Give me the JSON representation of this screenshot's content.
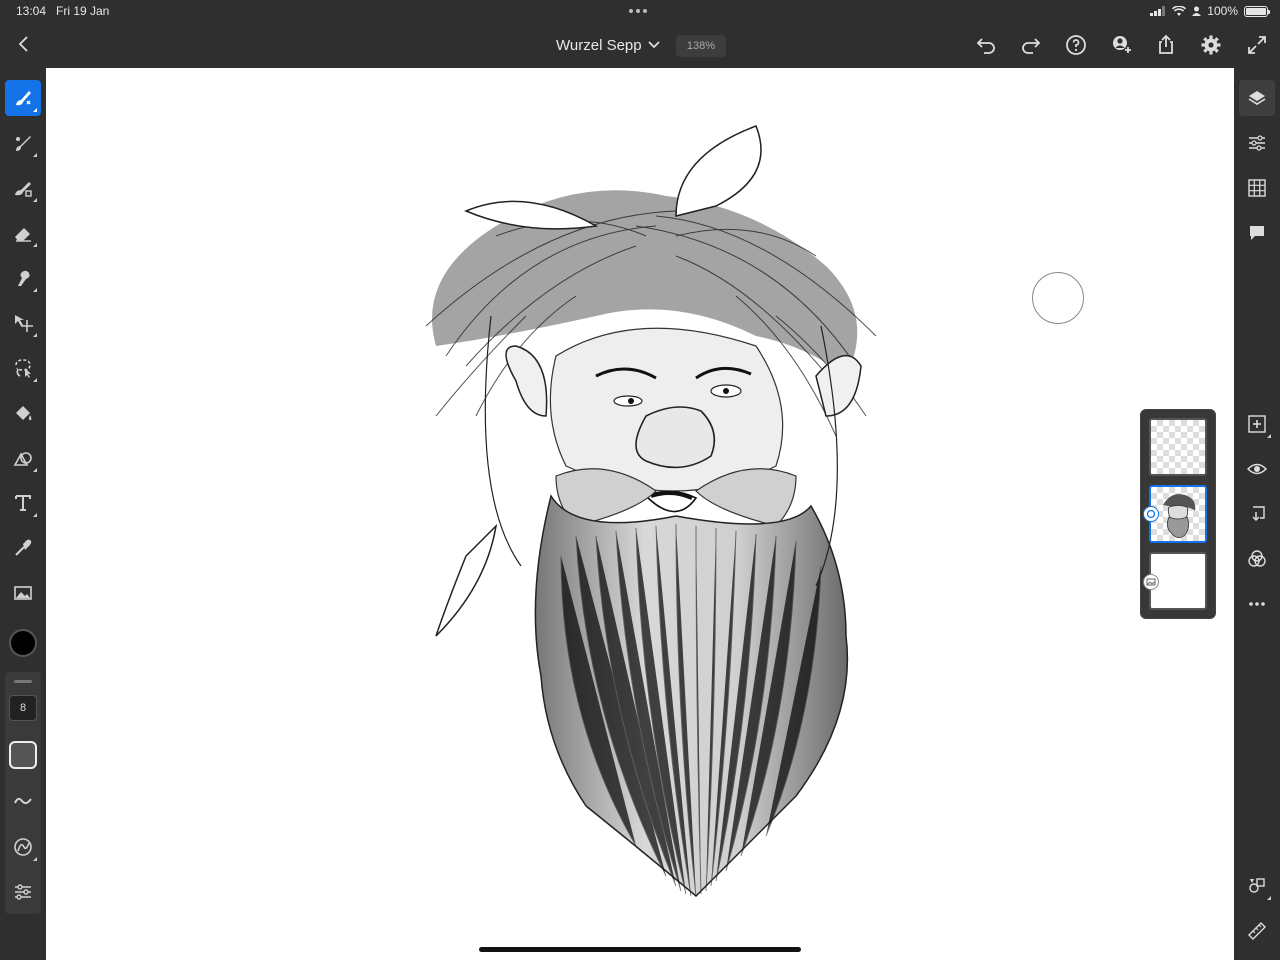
{
  "status_bar": {
    "time": "13:04",
    "date": "Fri 19 Jan",
    "battery": "100%"
  },
  "header": {
    "document_title": "Wurzel Sepp",
    "zoom_level": "138%",
    "icons": [
      "back-icon",
      "chevron-down-icon",
      "undo-icon",
      "redo-icon",
      "help-icon",
      "invite-icon",
      "share-icon",
      "gear-icon",
      "fullscreen-icon"
    ]
  },
  "left_toolbar": {
    "tools": [
      "pixel-brush",
      "live-brush",
      "vector-brush",
      "eraser",
      "smudge",
      "move-transform",
      "lasso-selection",
      "fill",
      "shapes",
      "text",
      "eyedropper",
      "place-image"
    ],
    "active_tool": "pixel-brush",
    "brush_size": "8",
    "current_color": "#000000"
  },
  "right_toolbar": {
    "icons": [
      "layers-icon",
      "layer-properties-icon",
      "grid-icon",
      "comments-icon",
      "add-layer-icon",
      "visibility-icon",
      "merge-down-icon",
      "blend-mode-icon",
      "more-icon",
      "shapes-icon",
      "ruler-icon"
    ]
  },
  "layers_panel": {
    "layers": [
      {
        "name": "empty-layer",
        "selected": false
      },
      {
        "name": "sketch-layer",
        "selected": true
      },
      {
        "name": "background-layer",
        "selected": false
      }
    ]
  },
  "colors": {
    "accent": "#1473e6",
    "chrome": "#2f2f2f",
    "canvas": "#ffffff"
  }
}
